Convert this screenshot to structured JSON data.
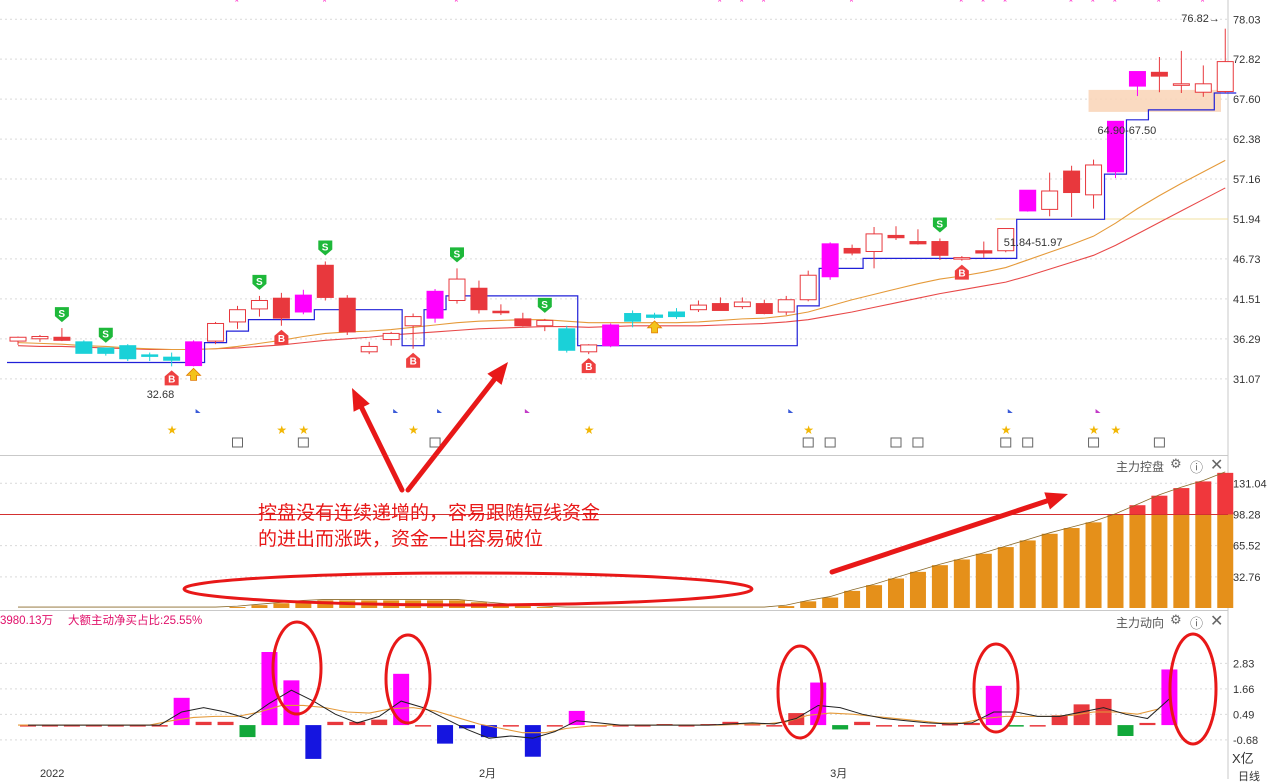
{
  "colors": {
    "up": "#e8383d",
    "down": "#1ad1d8",
    "magenta": "#ff00ff",
    "blue_line": "#2020d8",
    "ma_orange": "#e59a3a",
    "ma_red": "#e84848",
    "control_orange": "#e5901a",
    "control_red": "#f0373c",
    "flow_green": "#12a83a",
    "flow_blue": "#1515e0",
    "annotation_red": "#e81818",
    "zone_fill": "#f9d3b6"
  },
  "panels": {
    "control": {
      "title": "主力控盘"
    },
    "flow": {
      "title": "主力动向",
      "stat_a": "3980.13万",
      "stat_b": "大额主动净买占比:25.55%",
      "unit": "X亿"
    }
  },
  "toolbar_icons": [
    "settings-icon",
    "help-icon",
    "close-icon"
  ],
  "annotation": {
    "line1": "控盘没有连续递增的，容易跟随短线资金",
    "line2": "的进出而涨跌，资金一出容易破位"
  },
  "price_labels": {
    "high": "76.82",
    "zone_label": "64.90-67.50",
    "mid_label": "51.84-51.97",
    "low_label": "32.68"
  },
  "x_labels": [
    {
      "i": 1,
      "text": "2022"
    },
    {
      "i": 21,
      "text": "2月"
    },
    {
      "i": 37,
      "text": "3月"
    }
  ],
  "period_label": "日线",
  "chart_data": [
    {
      "type": "candlestick",
      "panel": "price",
      "y_ticks": [
        "78.03",
        "72.82",
        "67.60",
        "62.38",
        "57.16",
        "51.94",
        "46.73",
        "41.51",
        "36.29",
        "31.07"
      ],
      "ylim": [
        27.0,
        79.5
      ],
      "candles": [
        {
          "o": 36.0,
          "h": 36.6,
          "l": 35.5,
          "c": 36.5,
          "k": "up"
        },
        {
          "o": 36.3,
          "h": 36.8,
          "l": 35.9,
          "c": 36.6,
          "k": "up"
        },
        {
          "o": 36.5,
          "h": 37.7,
          "l": 36.0,
          "c": 36.1,
          "k": "upf"
        },
        {
          "o": 35.9,
          "h": 36.1,
          "l": 34.4,
          "c": 34.4,
          "k": "down"
        },
        {
          "o": 34.4,
          "h": 35.0,
          "l": 34.1,
          "c": 35.1,
          "k": "down"
        },
        {
          "o": 35.4,
          "h": 35.6,
          "l": 33.4,
          "c": 33.7,
          "k": "down"
        },
        {
          "o": 34.0,
          "h": 34.5,
          "l": 33.4,
          "c": 34.2,
          "k": "down"
        },
        {
          "o": 33.9,
          "h": 34.5,
          "l": 32.7,
          "c": 33.5,
          "k": "down"
        },
        {
          "o": 32.8,
          "h": 36.1,
          "l": 32.7,
          "c": 35.9,
          "k": "mag"
        },
        {
          "o": 36.0,
          "h": 38.5,
          "l": 35.6,
          "c": 38.3,
          "k": "up"
        },
        {
          "o": 38.5,
          "h": 40.6,
          "l": 37.6,
          "c": 40.1,
          "k": "up"
        },
        {
          "o": 40.2,
          "h": 41.9,
          "l": 39.2,
          "c": 41.3,
          "k": "up"
        },
        {
          "o": 41.6,
          "h": 42.3,
          "l": 38.0,
          "c": 39.0,
          "k": "upf"
        },
        {
          "o": 39.8,
          "h": 42.7,
          "l": 39.5,
          "c": 42.0,
          "k": "mag"
        },
        {
          "o": 41.7,
          "h": 46.4,
          "l": 41.3,
          "c": 45.9,
          "k": "upf"
        },
        {
          "o": 41.6,
          "h": 42.0,
          "l": 36.8,
          "c": 37.2,
          "k": "upf"
        },
        {
          "o": 35.3,
          "h": 35.9,
          "l": 34.3,
          "c": 34.6,
          "k": "up"
        },
        {
          "o": 36.2,
          "h": 37.2,
          "l": 35.4,
          "c": 37.0,
          "k": "up"
        },
        {
          "o": 38.0,
          "h": 39.6,
          "l": 35.0,
          "c": 39.2,
          "k": "up"
        },
        {
          "o": 39.0,
          "h": 42.8,
          "l": 38.4,
          "c": 42.5,
          "k": "mag"
        },
        {
          "o": 41.3,
          "h": 45.5,
          "l": 40.9,
          "c": 44.1,
          "k": "up"
        },
        {
          "o": 42.9,
          "h": 43.9,
          "l": 39.6,
          "c": 40.1,
          "k": "upf"
        },
        {
          "o": 39.9,
          "h": 40.8,
          "l": 39.4,
          "c": 39.7,
          "k": "upf"
        },
        {
          "o": 38.9,
          "h": 39.7,
          "l": 37.9,
          "c": 38.0,
          "k": "upf"
        },
        {
          "o": 38.0,
          "h": 38.9,
          "l": 37.3,
          "c": 38.7,
          "k": "up"
        },
        {
          "o": 37.6,
          "h": 38.0,
          "l": 34.5,
          "c": 34.8,
          "k": "down"
        },
        {
          "o": 34.6,
          "h": 35.6,
          "l": 34.3,
          "c": 35.5,
          "k": "up"
        },
        {
          "o": 35.4,
          "h": 38.3,
          "l": 35.2,
          "c": 38.1,
          "k": "mag"
        },
        {
          "o": 38.6,
          "h": 40.0,
          "l": 37.8,
          "c": 39.6,
          "k": "down"
        },
        {
          "o": 39.1,
          "h": 39.7,
          "l": 38.9,
          "c": 39.4,
          "k": "down"
        },
        {
          "o": 39.2,
          "h": 40.3,
          "l": 38.9,
          "c": 39.8,
          "k": "down"
        },
        {
          "o": 40.1,
          "h": 41.3,
          "l": 39.8,
          "c": 40.7,
          "k": "up"
        },
        {
          "o": 40.9,
          "h": 41.7,
          "l": 40.0,
          "c": 40.0,
          "k": "upf"
        },
        {
          "o": 40.5,
          "h": 41.7,
          "l": 40.2,
          "c": 41.1,
          "k": "up"
        },
        {
          "o": 40.9,
          "h": 41.4,
          "l": 39.5,
          "c": 39.6,
          "k": "upf"
        },
        {
          "o": 39.8,
          "h": 41.9,
          "l": 39.4,
          "c": 41.4,
          "k": "up"
        },
        {
          "o": 41.4,
          "h": 45.2,
          "l": 41.2,
          "c": 44.6,
          "k": "up"
        },
        {
          "o": 44.4,
          "h": 48.9,
          "l": 44.0,
          "c": 48.7,
          "k": "mag"
        },
        {
          "o": 48.1,
          "h": 48.6,
          "l": 47.2,
          "c": 47.5,
          "k": "upf"
        },
        {
          "o": 47.7,
          "h": 50.9,
          "l": 45.5,
          "c": 50.0,
          "k": "up"
        },
        {
          "o": 49.8,
          "h": 51.0,
          "l": 49.2,
          "c": 49.5,
          "k": "upf"
        },
        {
          "o": 49.0,
          "h": 50.6,
          "l": 48.6,
          "c": 48.7,
          "k": "upf"
        },
        {
          "o": 49.0,
          "h": 49.4,
          "l": 46.6,
          "c": 47.2,
          "k": "upf"
        },
        {
          "o": 46.8,
          "h": 47.1,
          "l": 46.5,
          "c": 46.9,
          "k": "up"
        },
        {
          "o": 47.8,
          "h": 49.0,
          "l": 46.9,
          "c": 47.5,
          "k": "upf"
        },
        {
          "o": 47.8,
          "h": 50.5,
          "l": 47.6,
          "c": 50.7,
          "k": "up"
        },
        {
          "o": 53.0,
          "h": 55.7,
          "l": 52.9,
          "c": 55.7,
          "k": "mag"
        },
        {
          "o": 53.2,
          "h": 58.0,
          "l": 52.3,
          "c": 55.6,
          "k": "up"
        },
        {
          "o": 58.2,
          "h": 58.9,
          "l": 52.2,
          "c": 55.4,
          "k": "upf"
        },
        {
          "o": 55.1,
          "h": 59.7,
          "l": 53.3,
          "c": 59.0,
          "k": "up"
        },
        {
          "o": 58.1,
          "h": 64.7,
          "l": 57.3,
          "c": 64.7,
          "k": "mag"
        },
        {
          "o": 69.3,
          "h": 71.2,
          "l": 68.0,
          "c": 71.2,
          "k": "mag"
        },
        {
          "o": 71.1,
          "h": 73.1,
          "l": 68.5,
          "c": 70.6,
          "k": "upf"
        },
        {
          "o": 69.4,
          "h": 73.9,
          "l": 68.4,
          "c": 69.6,
          "k": "up"
        },
        {
          "o": 68.5,
          "h": 72.0,
          "l": 67.9,
          "c": 69.6,
          "k": "up"
        },
        {
          "o": 68.6,
          "h": 76.8,
          "l": 68.4,
          "c": 72.5,
          "k": "up"
        }
      ],
      "ma_orange": [
        35.8,
        35.7,
        35.6,
        35.4,
        35.3,
        35.1,
        35.0,
        34.9,
        34.9,
        35.0,
        35.3,
        35.7,
        36.1,
        36.6,
        37.0,
        37.2,
        37.3,
        37.5,
        37.8,
        38.1,
        38.4,
        38.6,
        38.7,
        38.8,
        38.8,
        38.6,
        38.4,
        38.4,
        38.4,
        38.4,
        38.4,
        38.5,
        38.7,
        38.9,
        39.0,
        39.3,
        39.8,
        40.6,
        41.4,
        42.1,
        42.8,
        43.5,
        44.1,
        44.5,
        45.0,
        45.6,
        46.6,
        47.6,
        48.6,
        49.7,
        51.4,
        53.3,
        55.0,
        56.6,
        58.1,
        59.6
      ],
      "ma_red": [
        35.4,
        35.3,
        35.3,
        35.2,
        35.1,
        35.0,
        34.9,
        34.9,
        34.9,
        35.0,
        35.1,
        35.3,
        35.5,
        35.8,
        36.1,
        36.3,
        36.5,
        36.8,
        37.0,
        37.2,
        37.4,
        37.6,
        37.7,
        37.8,
        37.9,
        37.9,
        37.8,
        37.9,
        38.0,
        38.0,
        38.0,
        38.0,
        38.1,
        38.2,
        38.3,
        38.5,
        38.8,
        39.3,
        39.8,
        40.4,
        41.0,
        41.6,
        42.2,
        42.7,
        43.2,
        43.7,
        44.5,
        45.4,
        46.3,
        47.2,
        48.5,
        50.0,
        51.5,
        53.0,
        54.5,
        56.0
      ],
      "stop_line": [
        33.2,
        33.2,
        33.2,
        33.2,
        33.2,
        33.2,
        33.2,
        33.2,
        33.2,
        35.8,
        37.3,
        38.8,
        38.8,
        38.8,
        40.1,
        40.1,
        40.1,
        40.1,
        35.4,
        40.1,
        41.9,
        41.9,
        41.9,
        41.9,
        41.9,
        41.9,
        35.4,
        35.4,
        35.4,
        35.4,
        35.4,
        35.4,
        35.4,
        35.4,
        35.4,
        35.4,
        40.6,
        45.5,
        45.5,
        46.8,
        46.8,
        46.8,
        46.8,
        46.8,
        46.8,
        46.8,
        51.9,
        51.9,
        51.9,
        51.9,
        57.8,
        64.9,
        66.2,
        66.2,
        66.2,
        68.4
      ],
      "signals_S": [
        2,
        4,
        11,
        14,
        20,
        24,
        42
      ],
      "signals_B": [
        7,
        12,
        18,
        26,
        43
      ],
      "signals_arrow": [
        8,
        29
      ],
      "stars_bottom": [
        7,
        12,
        13,
        18,
        26,
        36,
        45,
        49,
        50
      ]
    },
    {
      "type": "bar",
      "panel": "control",
      "y_ticks": [
        "131.04",
        "98.28",
        "65.52",
        "32.76"
      ],
      "ylim": [
        0,
        145
      ],
      "threshold": 98.28,
      "values": [
        0,
        0,
        0,
        0,
        0,
        0,
        0,
        0,
        0,
        0,
        1,
        3,
        5,
        7,
        8,
        8,
        8,
        8,
        8,
        8,
        8,
        6,
        4,
        2,
        1,
        0,
        0,
        0,
        0,
        0,
        0,
        0,
        0,
        0,
        0,
        2,
        7,
        11,
        18,
        24,
        31,
        38,
        45,
        51,
        57,
        64,
        71,
        78,
        84,
        90,
        98,
        108,
        118,
        126,
        133,
        142
      ]
    },
    {
      "type": "bar",
      "panel": "flow",
      "y_ticks": [
        "2.83",
        "1.66",
        "0.49",
        "-0.68"
      ],
      "ylim": [
        -1.6,
        3.9
      ],
      "values": [
        0,
        0,
        0,
        0,
        0,
        0,
        0,
        1.25,
        0.15,
        0.15,
        -0.55,
        3.35,
        2.05,
        -1.55,
        0.15,
        0.15,
        0.25,
        2.35,
        0,
        -0.85,
        -0.15,
        -0.55,
        0,
        -1.45,
        0,
        0.65,
        0,
        0,
        0,
        0.05,
        0,
        0.05,
        0.15,
        0.05,
        0,
        0.55,
        1.95,
        -0.2,
        0.15,
        0,
        0,
        -0.05,
        0.05,
        0.1,
        1.8,
        -0.05,
        0,
        0.45,
        0.95,
        1.2,
        -0.5,
        0.1,
        2.55
      ],
      "kinds": [
        "up",
        "up",
        "up",
        "up",
        "up",
        "up",
        "up",
        "mag",
        "up",
        "up",
        "green",
        "mag",
        "mag",
        "blue",
        "up",
        "up",
        "up",
        "mag",
        "up",
        "blue",
        "blue",
        "blue",
        "up",
        "blue",
        "up",
        "mag",
        "up",
        "up",
        "up",
        "up",
        "up",
        "up",
        "up",
        "up",
        "up",
        "up",
        "mag",
        "green",
        "up",
        "up",
        "up",
        "up",
        "up",
        "up",
        "mag",
        "green",
        "up",
        "up",
        "up",
        "up",
        "green",
        "up",
        "mag"
      ],
      "line_black": [
        0,
        0,
        0,
        0,
        0,
        0,
        0,
        0.6,
        0.8,
        0.6,
        0.3,
        1.0,
        1.6,
        1.1,
        0.5,
        0.1,
        0.4,
        1.1,
        0.8,
        0.3,
        -0.2,
        -0.6,
        -0.5,
        -0.6,
        -0.3,
        0.2,
        0.1,
        0,
        0,
        0,
        0,
        0,
        0.05,
        0.1,
        0.05,
        0.3,
        0.9,
        0.8,
        0.5,
        0.3,
        0.2,
        0.1,
        0.05,
        0.1,
        0.6,
        0.6,
        0.4,
        0.4,
        0.6,
        0.8,
        0.5,
        0.3,
        1.2
      ],
      "line_orange": [
        0,
        0,
        0,
        0,
        0,
        0,
        0,
        0.2,
        0.35,
        0.4,
        0.4,
        0.6,
        0.9,
        0.9,
        0.8,
        0.6,
        0.55,
        0.75,
        0.8,
        0.65,
        0.35,
        0.05,
        -0.15,
        -0.35,
        -0.35,
        -0.15,
        -0.05,
        0,
        0,
        0,
        0,
        0,
        0,
        0.05,
        0.05,
        0.15,
        0.45,
        0.55,
        0.5,
        0.4,
        0.3,
        0.2,
        0.1,
        0.1,
        0.3,
        0.4,
        0.4,
        0.4,
        0.45,
        0.6,
        0.6,
        0.5,
        0.75
      ]
    }
  ]
}
